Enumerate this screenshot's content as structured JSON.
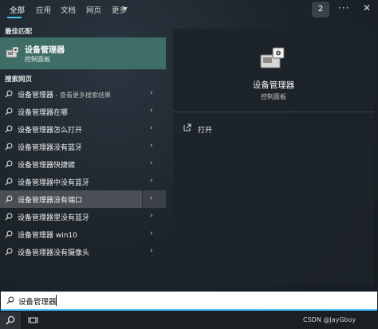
{
  "filters": {
    "all": "全部",
    "apps": "应用",
    "documents": "文档",
    "web": "网页",
    "more": "更多",
    "badge": "2",
    "more_options": "···",
    "close": "✕"
  },
  "best_match": {
    "section_label": "最佳匹配",
    "title": "设备管理器",
    "subtitle": "控制面板"
  },
  "search_web": {
    "section_label": "搜索网页",
    "items": [
      {
        "label": "设备管理器",
        "suffix": " - 查看更多搜索结果"
      },
      {
        "label": "设备管理器在哪",
        "suffix": ""
      },
      {
        "label": "设备管理器怎么打开",
        "suffix": ""
      },
      {
        "label": "设备管理器没有蓝牙",
        "suffix": ""
      },
      {
        "label": "设备管理器快捷键",
        "suffix": ""
      },
      {
        "label": "设备管理器中没有蓝牙",
        "suffix": ""
      },
      {
        "label": "设备管理器没有端口",
        "suffix": ""
      },
      {
        "label": "设备管理器里没有蓝牙",
        "suffix": ""
      },
      {
        "label": "设备管理器 win10",
        "suffix": ""
      },
      {
        "label": "设备管理器没有摄像头",
        "suffix": ""
      }
    ],
    "selected_index": 6,
    "arrow": "›"
  },
  "detail": {
    "title": "设备管理器",
    "subtitle": "控制面板",
    "open_label": "打开"
  },
  "search": {
    "value": "设备管理器"
  },
  "watermark": "CSDN @JayGboy",
  "colors": {
    "accent": "#4cc2ff",
    "best_match_bg": "#3f6e67",
    "selected_row_bg": "#4a4f55"
  }
}
